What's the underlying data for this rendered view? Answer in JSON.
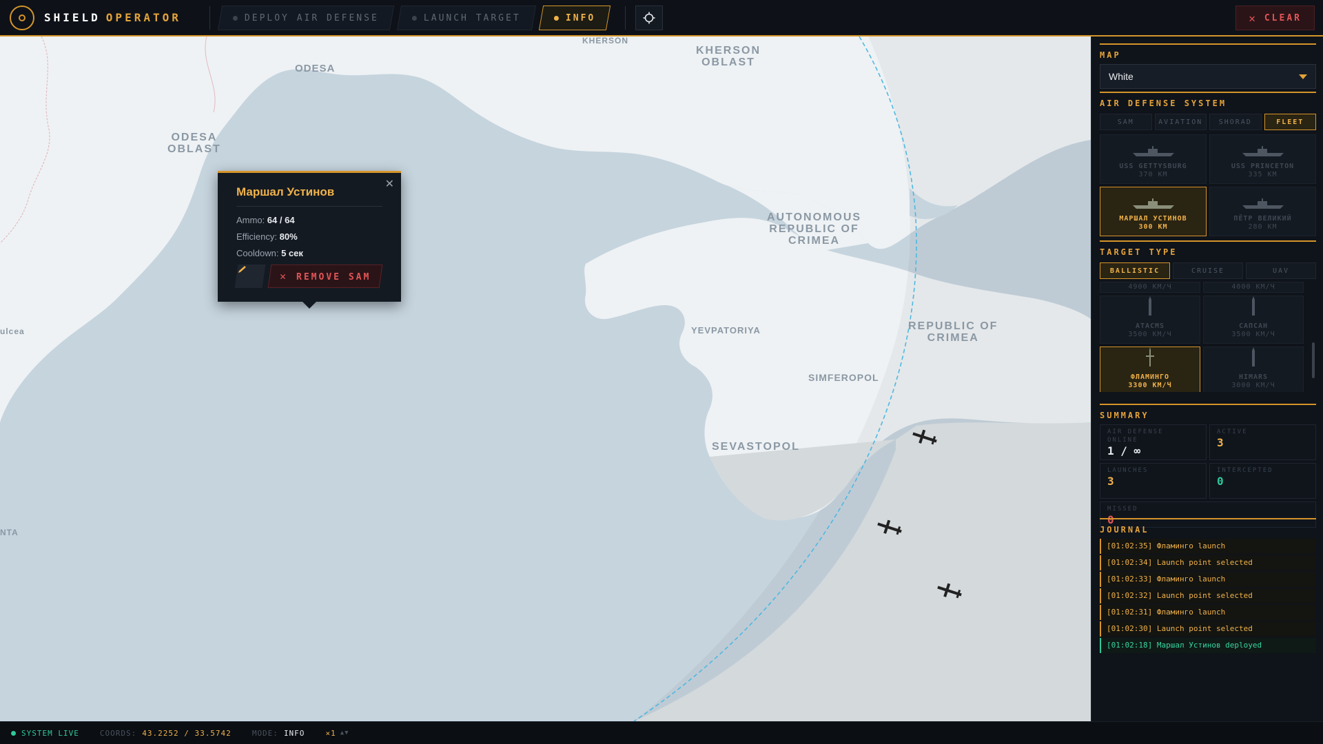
{
  "app": {
    "title_a": "SHIELD",
    "title_b": "OPERATOR"
  },
  "toolbar": {
    "tabs": [
      {
        "label": "DEPLOY AIR DEFENSE",
        "active": false
      },
      {
        "label": "LAUNCH TARGET",
        "active": false
      },
      {
        "label": "INFO",
        "active": true
      }
    ],
    "clear_label": "CLEAR"
  },
  "map_labels": {
    "kherson_obl": "KHERSON\nOBLAST",
    "kherson": "KHERSON",
    "odesa": "ODESA",
    "odesa_obl": "ODESA\nOBLAST",
    "crimea": "AUTONOMOUS\nREPUBLIC OF\nCRIMEA",
    "crimea_right": "REPUBLIC OF\nCRIMEA",
    "yevpatoriya": "YEVPATORIYA",
    "simferopol": "SIMFEROPOL",
    "sevastopol": "SEVASTOPOL",
    "tulcea": "ulcea",
    "nta": "NTA"
  },
  "popup": {
    "title": "Маршал Устинов",
    "ammo_label": "Ammo:",
    "ammo_value": "64 / 64",
    "efficiency_label": "Efficiency:",
    "efficiency_value": "80%",
    "cooldown_label": "Cooldown:",
    "cooldown_value": "5 сек",
    "remove_label": "REMOVE SAM"
  },
  "sidebar": {
    "map_section": {
      "title": "MAP",
      "selected": "White"
    },
    "ad_section": {
      "title": "AIR DEFENSE SYSTEM",
      "tabs": [
        "SAM",
        "AVIATION",
        "SHORAD",
        "FLEET"
      ],
      "active_tab": "FLEET",
      "cards": [
        {
          "name": "USS GETTYSBURG",
          "range": "370 KM"
        },
        {
          "name": "USS PRINCETON",
          "range": "335 KM"
        },
        {
          "name": "МАРШАЛ УСТИНОВ",
          "range": "300 KM"
        },
        {
          "name": "ПЁТР ВЕЛИКИЙ",
          "range": "280 KM"
        }
      ]
    },
    "target_section": {
      "title": "TARGET TYPE",
      "tabs": [
        "BALLISTIC",
        "CRUISE",
        "UAV"
      ],
      "active_tab": "BALLISTIC",
      "partial_row": [
        "4900 КМ/Ч",
        "4000 КМ/Ч"
      ],
      "cards": [
        {
          "name": "ATACMS",
          "speed": "3500 КМ/Ч"
        },
        {
          "name": "САПСАН",
          "speed": "3500 КМ/Ч"
        },
        {
          "name": "ФЛАМИНГО",
          "speed": "3300 КМ/Ч"
        },
        {
          "name": "HIMARS",
          "speed": "3000 КМ/Ч"
        }
      ]
    },
    "summary": {
      "title": "SUMMARY",
      "ad_online_label": "AIR DEFENSE ONLINE",
      "ad_online_value": "1 / ∞",
      "active_label": "ACTIVE",
      "active_value": "3",
      "launches_label": "LAUNCHES",
      "launches_value": "3",
      "intercepted_label": "INTERCEPTED",
      "intercepted_value": "0",
      "missed_label": "MISSED",
      "missed_value": "0"
    },
    "journal": {
      "title": "JOURNAL",
      "entries": [
        {
          "text": "[01:02:35] Фламинго launch",
          "type": "warn"
        },
        {
          "text": "[01:02:34] Launch point selected",
          "type": "warn"
        },
        {
          "text": "[01:02:33] Фламинго launch",
          "type": "warn"
        },
        {
          "text": "[01:02:32] Launch point selected",
          "type": "warn"
        },
        {
          "text": "[01:02:31] Фламинго launch",
          "type": "warn"
        },
        {
          "text": "[01:02:30] Launch point selected",
          "type": "warn"
        },
        {
          "text": "[01:02:18] Маршал Устинов deployed",
          "type": "ok"
        }
      ]
    }
  },
  "status": {
    "system": "SYSTEM LIVE",
    "coords_label": "COORDS:",
    "coords_value": "43.2252 / 33.5742",
    "mode_label": "MODE:",
    "mode_value": "INFO",
    "speed": "×1"
  },
  "colors": {
    "accent": "#d6952a",
    "ok": "#2fc99a",
    "danger": "#e35555",
    "range_circle": "#4fb8e0"
  }
}
